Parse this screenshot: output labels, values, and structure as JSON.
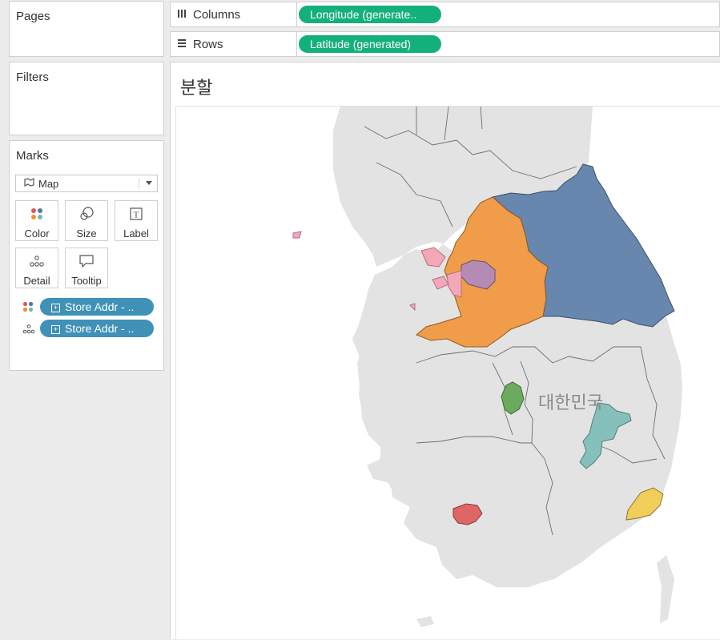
{
  "pages": {
    "title": "Pages"
  },
  "filters": {
    "title": "Filters"
  },
  "marks": {
    "title": "Marks",
    "mark_type": "Map",
    "buttons": {
      "color": "Color",
      "size": "Size",
      "label": "Label",
      "detail": "Detail",
      "tooltip": "Tooltip"
    },
    "fields": [
      {
        "label": "Store Addr - ..",
        "role": "color"
      },
      {
        "label": "Store Addr - ..",
        "role": "detail"
      }
    ]
  },
  "shelves": {
    "columns": {
      "label": "Columns",
      "pill": "Longitude (generate.."
    },
    "rows": {
      "label": "Rows",
      "pill": "Latitude (generated)"
    }
  },
  "sheet": {
    "title": "분할"
  },
  "map": {
    "country_label": "대한민국",
    "regions": [
      {
        "id": "blue-region",
        "color": "#6787ae"
      },
      {
        "id": "orange-region",
        "color": "#f09c48"
      },
      {
        "id": "purple-region",
        "color": "#b58bb5"
      },
      {
        "id": "pink-region",
        "color": "#f4a7b9"
      },
      {
        "id": "green-region",
        "color": "#6caa5e"
      },
      {
        "id": "teal-region",
        "color": "#86c0ba"
      },
      {
        "id": "red-region",
        "color": "#e06666"
      },
      {
        "id": "yellow-region",
        "color": "#f1cd5a"
      }
    ]
  }
}
